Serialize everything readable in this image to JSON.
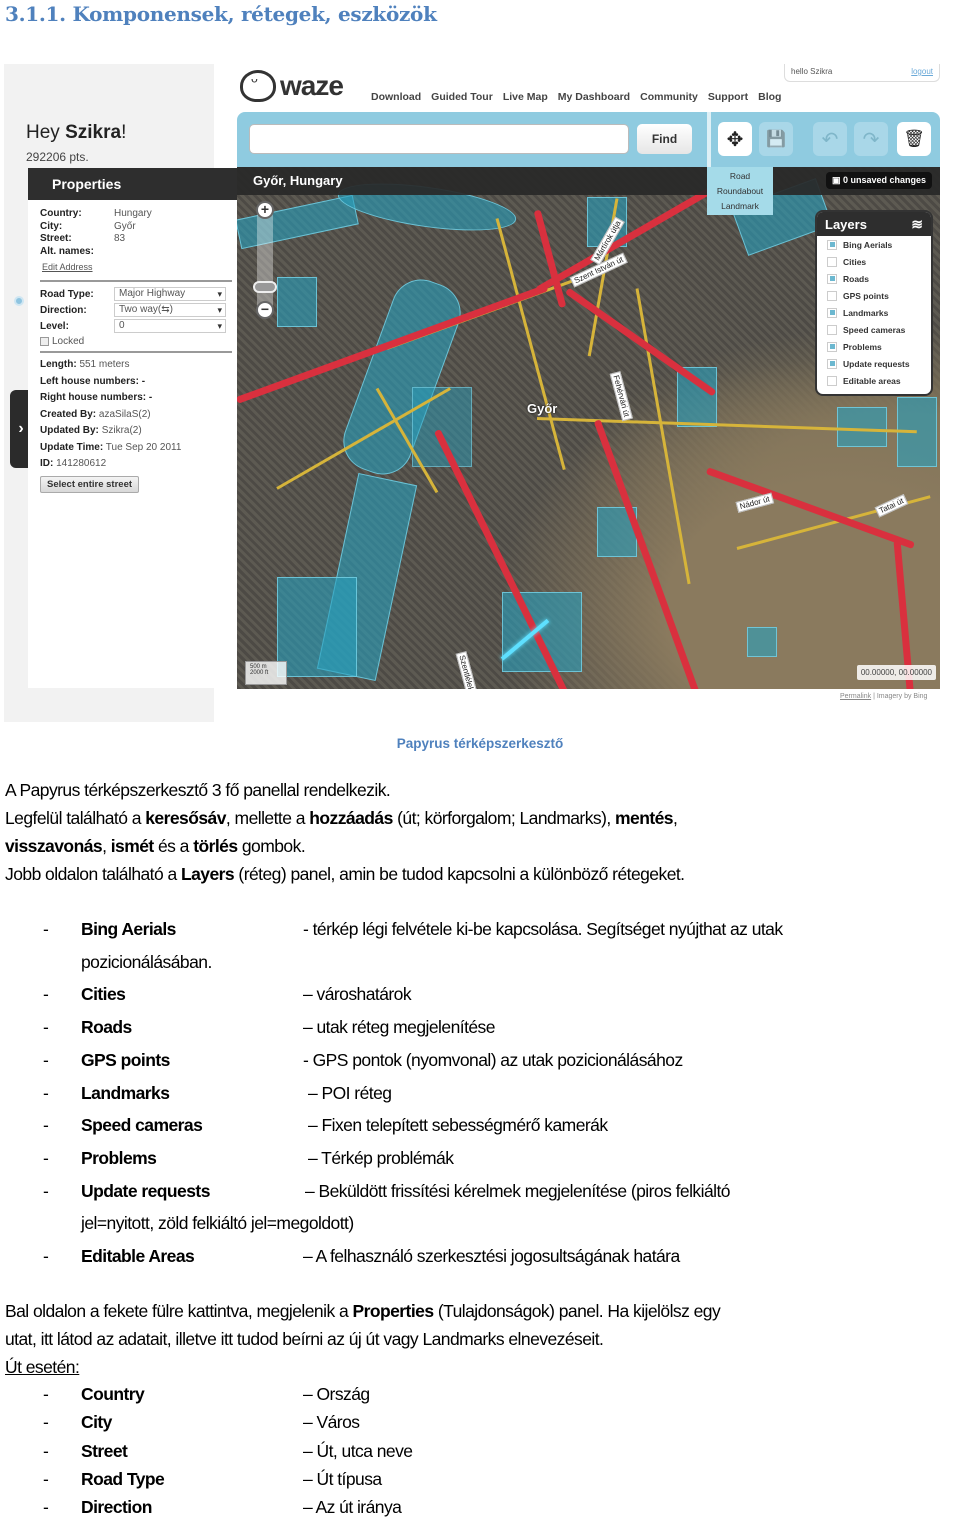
{
  "heading": "3.1.1. Komponensek, rétegek, eszközök",
  "screenshot": {
    "greeting_prefix": "Hey ",
    "greeting_name": "Szikra",
    "greeting_suffix": "!",
    "points": "292206 pts.",
    "logo_text": "waze",
    "nav": [
      "Download",
      "Guided Tour",
      "Live Map",
      "My Dashboard",
      "Community",
      "Support",
      "Blog"
    ],
    "user_hello": "hello Szikra",
    "logout": "logout",
    "search_placeholder": "",
    "find_label": "Find",
    "toolbar_icons": [
      {
        "name": "add-icon",
        "glyph": "✥",
        "state": "on"
      },
      {
        "name": "save-icon",
        "glyph": "💾",
        "state": "off"
      },
      {
        "name": "undo-icon",
        "glyph": "↶",
        "state": "off"
      },
      {
        "name": "redo-icon",
        "glyph": "↷",
        "state": "off"
      },
      {
        "name": "trash-icon",
        "glyph": "🗑",
        "state": "on"
      }
    ],
    "add_menu": [
      "Road",
      "Roundabout",
      "Landmark"
    ],
    "map_title": "Győr, Hungary",
    "unsaved": "0 unsaved changes",
    "city_label": "Győr",
    "properties": {
      "title": "Properties",
      "country_label": "Country:",
      "country": "Hungary",
      "city_label": "City:",
      "city": "Győr",
      "street_label": "Street:",
      "street": "83",
      "alt_names_label": "Alt. names:",
      "edit_address": "Edit Address",
      "road_type_label": "Road Type:",
      "road_type": "Major Highway",
      "direction_label": "Direction:",
      "direction": "Two way(⇆)",
      "level_label": "Level:",
      "level": "0",
      "locked_label": "Locked",
      "length_label": "Length:",
      "length": "551 meters",
      "left_house_label": "Left house numbers:",
      "left_house": "-",
      "right_house_label": "Right house numbers:",
      "right_house": "-",
      "created_by_label": "Created By:",
      "created_by": "azaSilaS(2)",
      "updated_by_label": "Updated By:",
      "updated_by": "Szikra(2)",
      "update_time_label": "Update Time:",
      "update_time": "Tue Sep 20 2011",
      "id_label": "ID:",
      "id": "141280612",
      "select_street": "Select entire street"
    },
    "layers": {
      "title": "Layers",
      "items": [
        {
          "label": "Bing Aerials",
          "checked": true
        },
        {
          "label": "Cities",
          "checked": false
        },
        {
          "label": "Roads",
          "checked": true
        },
        {
          "label": "GPS points",
          "checked": false
        },
        {
          "label": "Landmarks",
          "checked": true
        },
        {
          "label": "Speed cameras",
          "checked": false
        },
        {
          "label": "Problems",
          "checked": true
        },
        {
          "label": "Update requests",
          "checked": true
        },
        {
          "label": "Editable areas",
          "checked": false
        }
      ]
    },
    "map_labels": [
      "Szent István út",
      "Mártírok útja",
      "Nádor út",
      "Tatai út",
      "Fehérvári út",
      "Szentlélek utca"
    ],
    "scale_m": "500 m",
    "scale_ft": "2000 ft",
    "coords": "00.00000, 00.00000",
    "permalink": "Permalink",
    "imagery": "Imagery by Bing"
  },
  "caption": "Papyrus térképszerkesztő",
  "intro": {
    "line1": "A Papyrus térképszerkesztő 3 fő panellal rendelkezik.",
    "line2_a": "Legfelül található a ",
    "line2_b": "keresősáv",
    "line2_c": ", mellette a ",
    "line2_d": "hozzáadás",
    "line2_e": " (út; körforgalom; Landmarks), ",
    "line2_f": "mentés",
    "line2_g": ",",
    "line3_a": "visszavonás",
    "line3_b": ", ",
    "line3_c": "ismét",
    "line3_d": " és a ",
    "line3_e": "törlés",
    "line3_f": " gombok.",
    "line4_a": "Jobb oldalon található a ",
    "line4_b": "Layers",
    "line4_c": " (réteg) panel, amin be tudod kapcsolni a különböző rétegeket."
  },
  "layer_list": [
    {
      "term": "Bing Aerials",
      "desc": "- térkép légi felvétele ki-be kapcsolása. Segítséget nyújthat az utak",
      "cont": "pozicionálásában."
    },
    {
      "term": "Cities",
      "desc": "– városhatárok"
    },
    {
      "term": "Roads",
      "desc": "– utak réteg megjelenítése"
    },
    {
      "term": "GPS points",
      "desc": "- GPS pontok (nyomvonal) az utak pozicionálásához"
    },
    {
      "term": "Landmarks",
      "desc": "– POI réteg"
    },
    {
      "term": "Speed cameras",
      "desc": "– Fixen telepített sebességmérő kamerák"
    },
    {
      "term": "Problems",
      "desc": "– Térkép problémák"
    },
    {
      "term": "Update requests",
      "desc": "– Beküldött frissítési kérelmek megjelenítése (piros felkiáltó",
      "cont": "jel=nyitott, zöld felkiáltó jel=megoldott)"
    },
    {
      "term": "Editable Areas",
      "desc": "– A felhasználó szerkesztési jogosultságának határa"
    }
  ],
  "props_text": {
    "line1_a": "Bal oldalon a fekete fülre kattintva, megjelenik a ",
    "line1_b": "Properties",
    "line1_c": " (Tulajdonságok) panel. Ha kijelölsz egy",
    "line2": "utat, itt látod az adatait, illetve itt tudod beírni az új út vagy Landmarks elnevezéseit.",
    "subhead": "Út esetén:"
  },
  "road_list": [
    {
      "term": "Country",
      "desc": "– Ország"
    },
    {
      "term": "City",
      "desc": "– Város"
    },
    {
      "term": "Street",
      "desc": "– Út, utca neve"
    },
    {
      "term": "Road Type",
      "desc": "– Út típusa"
    },
    {
      "term": "Direction",
      "desc": "– Az út iránya"
    }
  ],
  "dash": "-"
}
